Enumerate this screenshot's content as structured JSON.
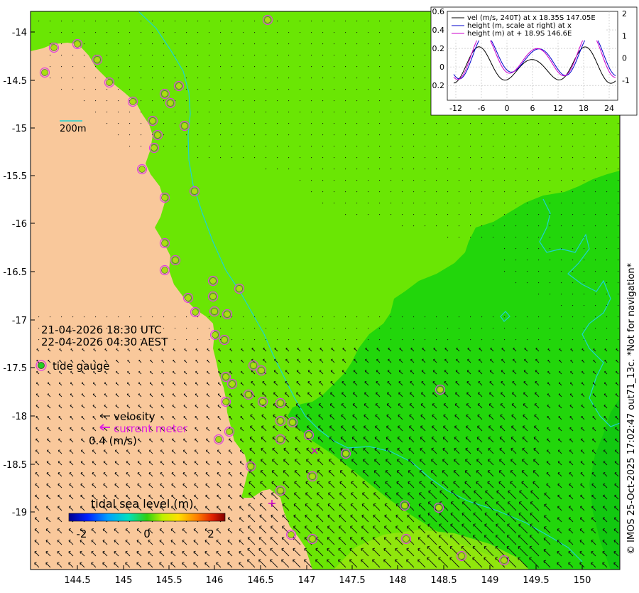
{
  "map": {
    "lon_ticks": [
      "144.5",
      "145",
      "145.5",
      "146",
      "146.5",
      "147",
      "147.5",
      "148",
      "148.5",
      "149",
      "149.5",
      "150"
    ],
    "lat_ticks": [
      "-14",
      "-14.5",
      "-15",
      "-15.5",
      "-16",
      "-16.5",
      "-17",
      "-17.5",
      "-18",
      "-18.5",
      "-19"
    ],
    "scale_label": "200m",
    "time_utc": "21-04-2026 18:30 UTC",
    "time_aest": "22-04-2026 04:30 AEST",
    "side_text": "© IMOS 25-Oct-2025 17:02:47 out71_13c. *Not for navigation*",
    "colors": {
      "land": "#f9c89b",
      "sea_main": "#6ae604",
      "sea_deep": "#22d60b",
      "sea_deeper": "#12c810",
      "contour": "#1cd3d3",
      "gauge_ring": "#e040e0",
      "arrow": "#111111"
    }
  },
  "legend": {
    "tide_gauge": "tide gauge",
    "velocity": "velocity",
    "current_meter": "current meter",
    "scale_value": "0.4 (m/s)"
  },
  "colorbar": {
    "title": "tidal sea level (m)",
    "ticks": [
      "-2",
      "0",
      "2"
    ],
    "range": [
      -2.4,
      2.4
    ]
  },
  "inset": {
    "legend": [
      {
        "text": "vel (m/s, 240T) at x 18.35S 147.05E",
        "color": "#000000"
      },
      {
        "text": "height (m, scale at right) at x",
        "color": "#0000cc"
      },
      {
        "text": "height (m) at + 18.9S 146.6E",
        "color": "#cc00cc"
      }
    ],
    "x_ticks": [
      "-12",
      "-6",
      "0",
      "6",
      "12",
      "18",
      "24"
    ],
    "left_ticks": [
      "0.6",
      "0.4",
      "0.2",
      "0",
      "0.2"
    ],
    "right_ticks": [
      "2",
      "1",
      "0",
      "-1"
    ],
    "series": {
      "vel": {
        "amplitude": 0.2,
        "period_h": 12.4,
        "phase_h": -6.5
      },
      "height_x": {
        "amplitude": 1.0,
        "period_h": 12.4,
        "phase_h": -5.0
      },
      "height_plus": {
        "amplitude": 1.05,
        "period_h": 12.4,
        "phase_h": -5.4
      }
    }
  }
}
